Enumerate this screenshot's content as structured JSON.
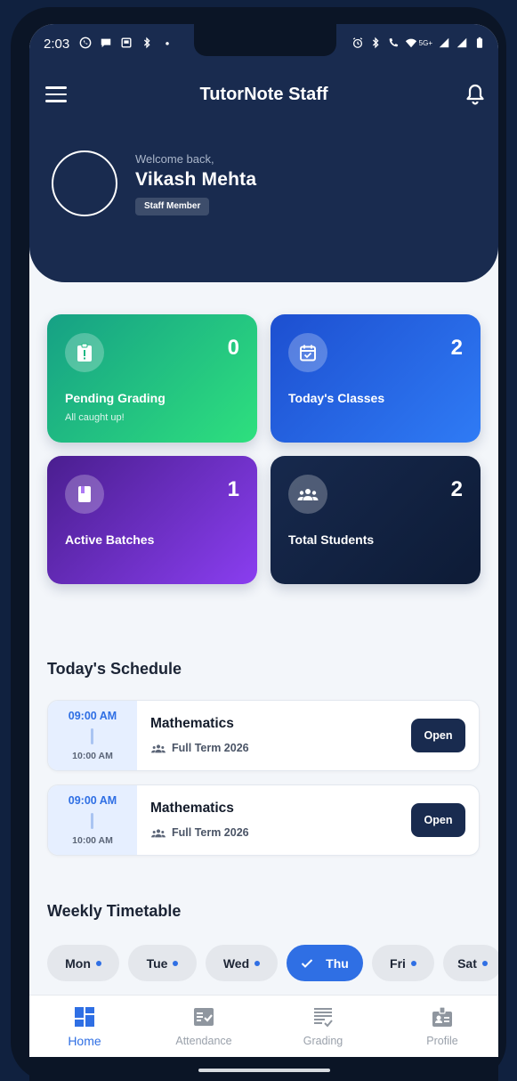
{
  "status_bar": {
    "time": "2:03",
    "network": "5G+"
  },
  "app_bar": {
    "title": "TutorNote Staff"
  },
  "profile": {
    "welcome": "Welcome back,",
    "name": "Vikash Mehta",
    "role": "Staff Member"
  },
  "stats": [
    {
      "label": "Pending Grading",
      "value": "0",
      "sub": "All caught up!",
      "icon": "clipboard-alert-icon"
    },
    {
      "label": "Today's Classes",
      "value": "2",
      "icon": "calendar-check-icon"
    },
    {
      "label": "Active Batches",
      "value": "1",
      "icon": "book-icon"
    },
    {
      "label": "Total Students",
      "value": "2",
      "icon": "people-icon"
    }
  ],
  "schedule": {
    "title": "Today's Schedule",
    "items": [
      {
        "start": "09:00 AM",
        "end": "10:00 AM",
        "subject": "Mathematics",
        "batch": "Full Term 2026",
        "action": "Open"
      },
      {
        "start": "09:00 AM",
        "end": "10:00 AM",
        "subject": "Mathematics",
        "batch": "Full Term 2026",
        "action": "Open"
      }
    ]
  },
  "timetable": {
    "title": "Weekly Timetable",
    "days": [
      {
        "label": "Mon",
        "selected": false
      },
      {
        "label": "Tue",
        "selected": false
      },
      {
        "label": "Wed",
        "selected": false
      },
      {
        "label": "Thu",
        "selected": true
      },
      {
        "label": "Fri",
        "selected": false
      },
      {
        "label": "Sat",
        "selected": false
      }
    ]
  },
  "nav": {
    "items": [
      {
        "label": "Home",
        "icon": "dashboard-icon",
        "active": true
      },
      {
        "label": "Attendance",
        "icon": "attendance-icon",
        "active": false
      },
      {
        "label": "Grading",
        "icon": "grading-icon",
        "active": false
      },
      {
        "label": "Profile",
        "icon": "badge-icon",
        "active": false
      }
    ]
  },
  "colors": {
    "header": "#192b4f",
    "accent": "#2f6fe4",
    "background": "#f3f6fa"
  }
}
